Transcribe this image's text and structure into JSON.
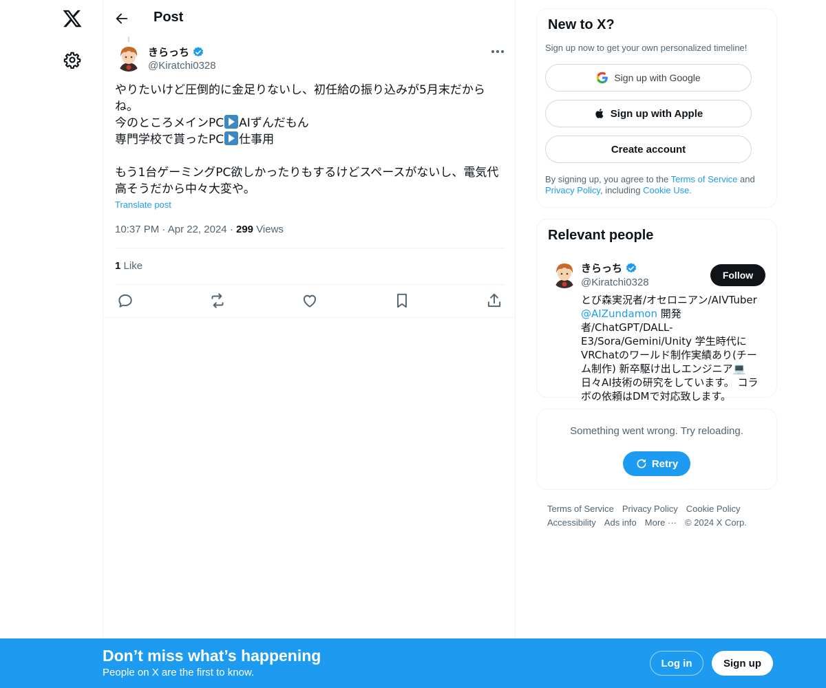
{
  "header": {
    "title": "Post"
  },
  "post": {
    "author_name": "きらっち",
    "author_handle": "@Kiratchi0328",
    "text_line1": "やりたいけど圧倒的に金足りないし、初任給の振り込みが5月末だから",
    "text_line2": "ね。",
    "text_line3a": "今のところメインPC",
    "text_line3b": "AIずんだもん",
    "text_line4a": "専門学校で貰ったPC",
    "text_line4b": "仕事用",
    "text_line6": "もう1台ゲーミングPC欲しかったりもするけどスペースがないし、電気代",
    "text_line7": "高そうだから中々大変や。",
    "translate_label": "Translate post",
    "time": "10:37 PM",
    "date": "Apr 22, 2024",
    "views_count": "299",
    "views_label": "Views",
    "like_count": "1",
    "like_label": "Like"
  },
  "signup_card": {
    "title": "New to X?",
    "subtitle": "Sign up now to get your own personalized timeline!",
    "google_label": "Sign up with Google",
    "apple_label": "Sign up with Apple",
    "create_label": "Create account",
    "legal_prefix": "By signing up, you agree to the ",
    "terms_label": "Terms of Service",
    "legal_and": " and",
    "privacy_label": "Privacy Policy",
    "legal_including": ", including ",
    "cookie_label": "Cookie Use."
  },
  "relevant": {
    "title": "Relevant people",
    "name": "きらっち",
    "handle": "@Kiratchi0328",
    "follow_label": "Follow",
    "bio_part1": "とび森実況者/オセロニアン/AIVTuber ",
    "bio_mention": "@AIZundamon",
    "bio_part2": " 開発者/ChatGPT/DALL-E3/Sora/Gemini/Unity 学生時代にVRChatのワールド制作実績あり(チーム制作) 新卒駆け出しエンジニア💻 日々AI技術の研究をしています。 コラボの依頼はDMで対応致します。"
  },
  "error_card": {
    "message": "Something went wrong. Try reloading.",
    "retry_label": "Retry"
  },
  "footer": {
    "terms": "Terms of Service",
    "privacy": "Privacy Policy",
    "cookie": "Cookie Policy",
    "accessibility": "Accessibility",
    "ads": "Ads info",
    "more": "More ···",
    "copyright": "© 2024 X Corp."
  },
  "bottom_bar": {
    "title": "Don’t miss what’s happening",
    "subtitle": "People on X are the first to know.",
    "login_label": "Log in",
    "signup_label": "Sign up"
  },
  "colors": {
    "accent": "#1d9bf0",
    "text": "#0f1419",
    "muted": "#536471",
    "border": "#eff3f4"
  }
}
